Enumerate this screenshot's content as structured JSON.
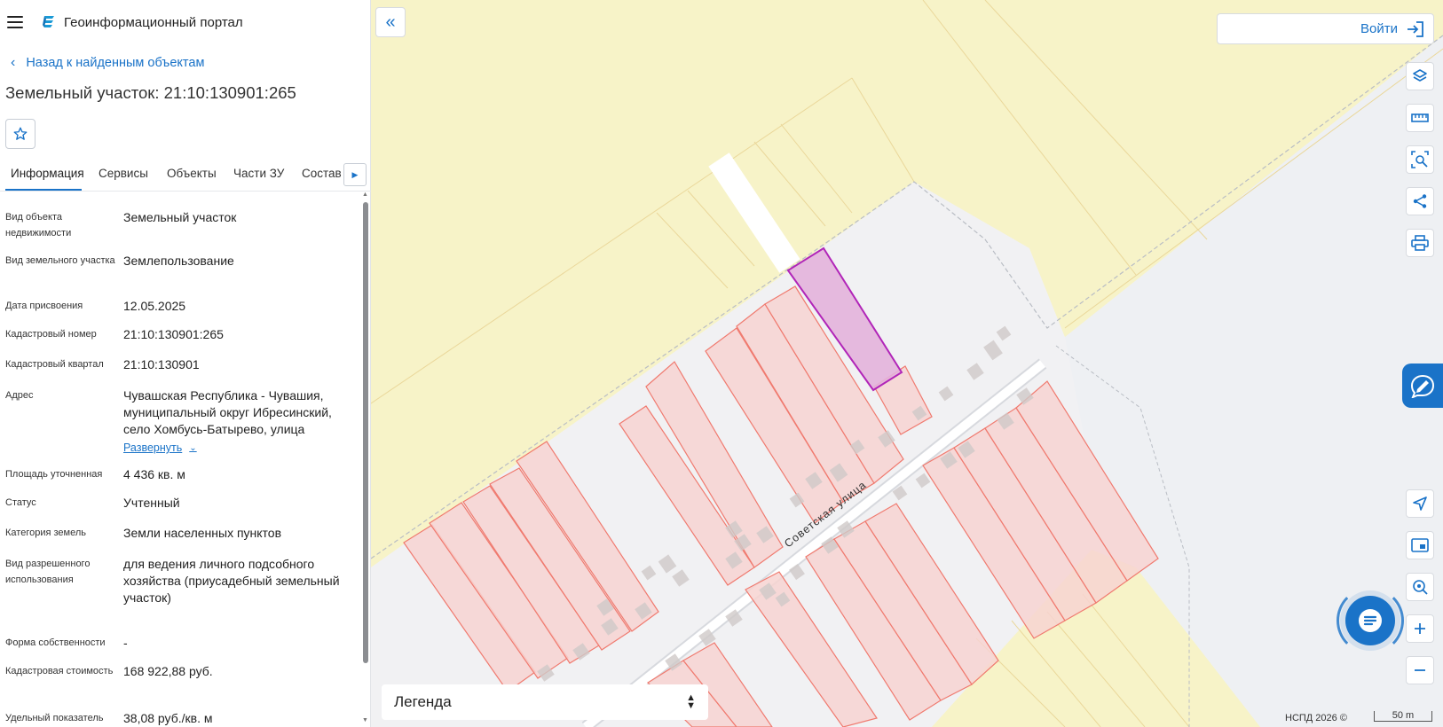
{
  "header": {
    "portal_title": "Геоинформационный портал"
  },
  "nav": {
    "back_label": "Назад к найденным объектам"
  },
  "object": {
    "title": "Земельный участок: 21:10:130901:265"
  },
  "tabs": [
    {
      "label": "Информация",
      "active": true
    },
    {
      "label": "Сервисы"
    },
    {
      "label": "Объекты"
    },
    {
      "label": "Части ЗУ"
    },
    {
      "label": "Состав"
    }
  ],
  "info": [
    {
      "label": "Вид объекта недвижимости",
      "value": "Земельный участок"
    },
    {
      "label": "Вид земельного участка",
      "value": "Землепользование"
    },
    {
      "label": "Дата присвоения",
      "value": "12.05.2025"
    },
    {
      "label": "Кадастровый номер",
      "value": "21:10:130901:265"
    },
    {
      "label": "Кадастровый квартал",
      "value": "21:10:130901"
    },
    {
      "label": "Адрес",
      "value": "Чувашская Республика - Чувашия, муниципальный округ Ибресинский, село Хомбусь-Батырево, улица",
      "expand_label": "Развернуть"
    },
    {
      "label": "Площадь уточненная",
      "value": "4 436 кв. м"
    },
    {
      "label": "Статус",
      "value": "Учтенный"
    },
    {
      "label": "Категория земель",
      "value": "Земли населенных пунктов"
    },
    {
      "label": "Вид разрешенного использования",
      "value": "для ведения личного подсобного хозяйства (приусадебный земельный участок)"
    },
    {
      "label": "Форма собственности",
      "value": "-"
    },
    {
      "label": "Кадастровая стоимость",
      "value": "168 922,88 руб."
    },
    {
      "label": "Удельный показатель",
      "value": "38,08 руб./кв. м"
    }
  ],
  "map": {
    "login_label": "Войти",
    "street_label": "Советская улица",
    "legend_label": "Легенда",
    "attribution": "НСПД 2026 ©",
    "scale_label": "50 m"
  },
  "colors": {
    "accent": "#1a73c8",
    "selected_parcel": "#b125b8",
    "parcel_stroke": "#f07a6f",
    "parcel_fill": "#f7d4d1",
    "field_fill": "#f7f3c8"
  },
  "icons": {
    "menu": "menu-icon",
    "logo": "portal-logo-icon",
    "back": "chevron-left-icon",
    "favorite": "star-icon",
    "collapse": "double-chevron-left-icon",
    "login": "login-icon",
    "tools": [
      "layers-icon",
      "ruler-icon",
      "area-search-icon",
      "share-icon",
      "print-icon",
      "locate-icon",
      "minimap-icon",
      "geo-search-icon",
      "zoom-in-icon",
      "zoom-out-icon"
    ],
    "chat": "chat-icon"
  }
}
